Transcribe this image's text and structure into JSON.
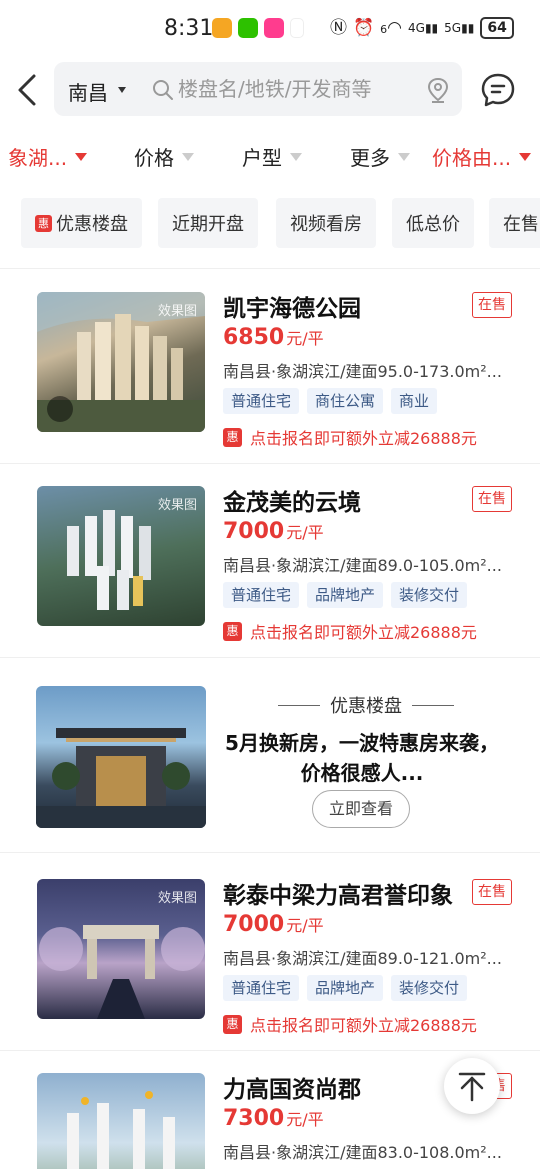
{
  "status_bar": {
    "time": "8:31",
    "network_4g": "4G",
    "network_5g": "5G",
    "wifi_index": "6",
    "battery": "64"
  },
  "header": {
    "city": "南昌",
    "search_placeholder": "楼盘名/地铁/开发商等"
  },
  "filters": [
    {
      "label": "象湖...",
      "active": true
    },
    {
      "label": "价格",
      "active": false
    },
    {
      "label": "户型",
      "active": false
    },
    {
      "label": "更多",
      "active": false
    },
    {
      "label": "价格由...",
      "active": true
    }
  ],
  "chips": [
    {
      "label": "优惠楼盘",
      "badge": "惠"
    },
    {
      "label": "近期开盘"
    },
    {
      "label": "视频看房"
    },
    {
      "label": "低总价"
    },
    {
      "label": "在售"
    }
  ],
  "listings": [
    {
      "name": "凯宇海德公园",
      "status": "在售",
      "price": "6850",
      "price_unit": "元/平",
      "location": "南昌县·象湖滨江/建面95.0-173.0m²...",
      "tags": [
        "普通住宅",
        "商住公寓",
        "商业"
      ],
      "promo_badge": "惠",
      "promo": "点击报名即可额外立减26888元",
      "thumb_tag": "效果图"
    },
    {
      "name": "金茂美的云境",
      "status": "在售",
      "price": "7000",
      "price_unit": "元/平",
      "location": "南昌县·象湖滨江/建面89.0-105.0m²...",
      "tags": [
        "普通住宅",
        "品牌地产",
        "装修交付"
      ],
      "promo_badge": "惠",
      "promo": "点击报名即可额外立减26888元",
      "thumb_tag": "效果图"
    },
    {
      "name": "彰泰中梁力高君誉印象",
      "status": "在售",
      "price": "7000",
      "price_unit": "元/平",
      "location": "南昌县·象湖滨江/建面89.0-121.0m²...",
      "tags": [
        "普通住宅",
        "品牌地产",
        "装修交付"
      ],
      "promo_badge": "惠",
      "promo": "点击报名即可额外立减26888元",
      "thumb_tag": "效果图"
    },
    {
      "name": "力高国资尚郡",
      "status": "在售",
      "price": "7300",
      "price_unit": "元/平",
      "location": "南昌县·象湖滨江/建面83.0-108.0m²...",
      "tags": [],
      "promo_badge": "",
      "promo": "",
      "thumb_tag": ""
    }
  ],
  "ad": {
    "header": "优惠楼盘",
    "title": "5月换新房，一波特惠房来袭，价格很感人...",
    "button": "立即查看"
  },
  "colors": {
    "accent_red": "#e53935",
    "tag_bg": "#eef3fb",
    "tag_text": "#3d5a86"
  }
}
